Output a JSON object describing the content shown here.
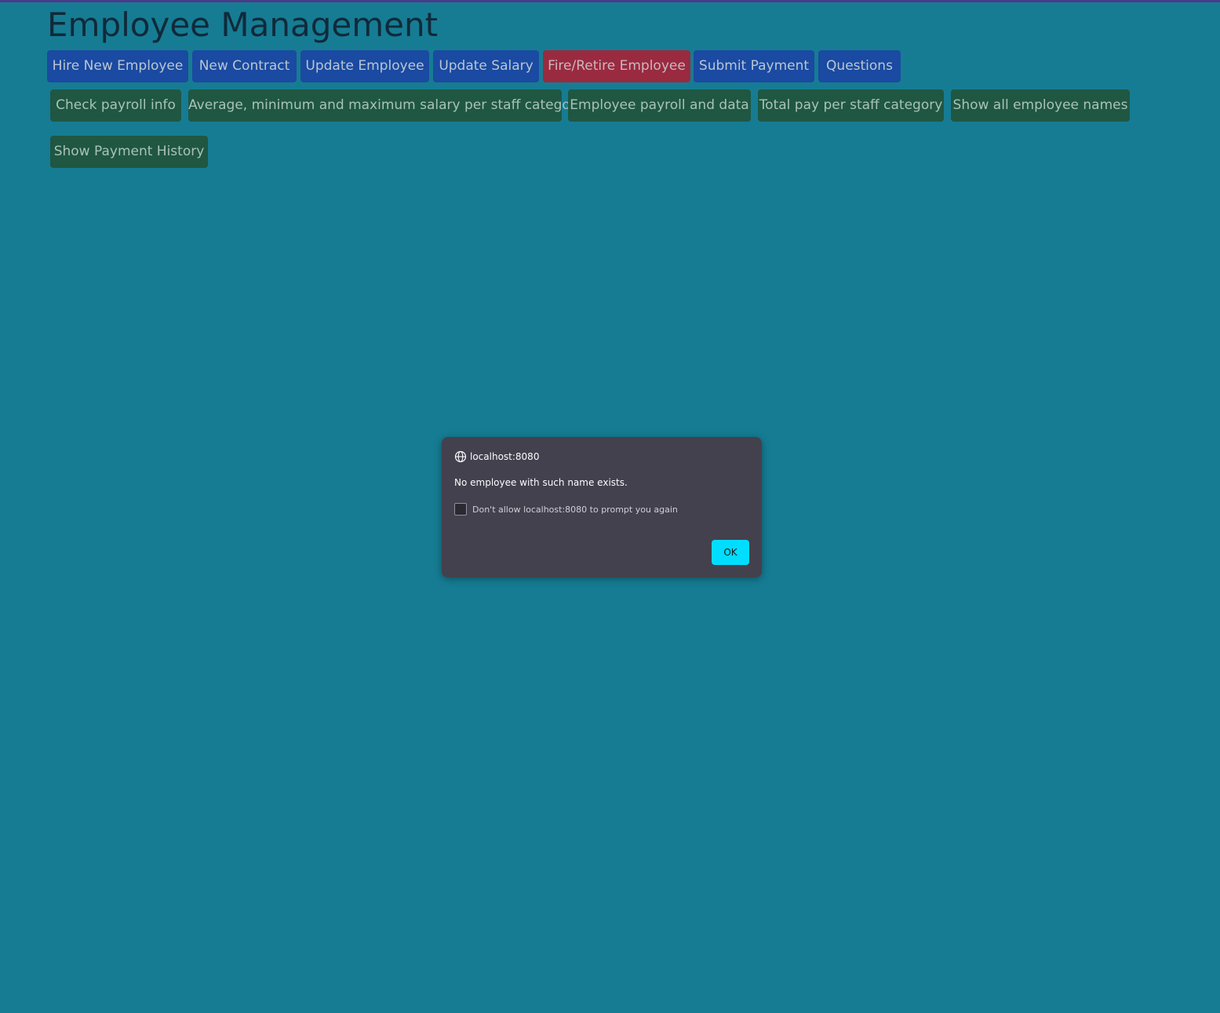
{
  "page": {
    "title": "Employee Management"
  },
  "actions_primary": [
    {
      "label": "Hire New Employee"
    },
    {
      "label": "New Contract"
    },
    {
      "label": "Update Employee"
    },
    {
      "label": "Update Salary"
    },
    {
      "label": "Fire/Retire Employee"
    },
    {
      "label": "Submit Payment"
    },
    {
      "label": "Questions"
    }
  ],
  "actions_reports": [
    {
      "label": "Check payroll info"
    },
    {
      "label": "Average, minimum and maximum salary per staff category"
    },
    {
      "label": "Employee payroll and data"
    },
    {
      "label": "Total pay per staff category"
    },
    {
      "label": "Show all employee names"
    },
    {
      "label": "Show Payment History"
    }
  ],
  "dialog": {
    "origin": "localhost:8080",
    "origin_icon": "globe-icon",
    "message": "No employee with such name exists.",
    "checkbox_label": "Don't allow localhost:8080 to prompt you again",
    "checkbox_checked": false,
    "ok_label": "OK"
  },
  "colors": {
    "background": "#167c93",
    "primary_button": "#1a4aa1",
    "danger_button": "#9a2a3f",
    "report_button": "#1f5742",
    "dialog_background": "#42414d",
    "dialog_ok": "#00ddff"
  }
}
